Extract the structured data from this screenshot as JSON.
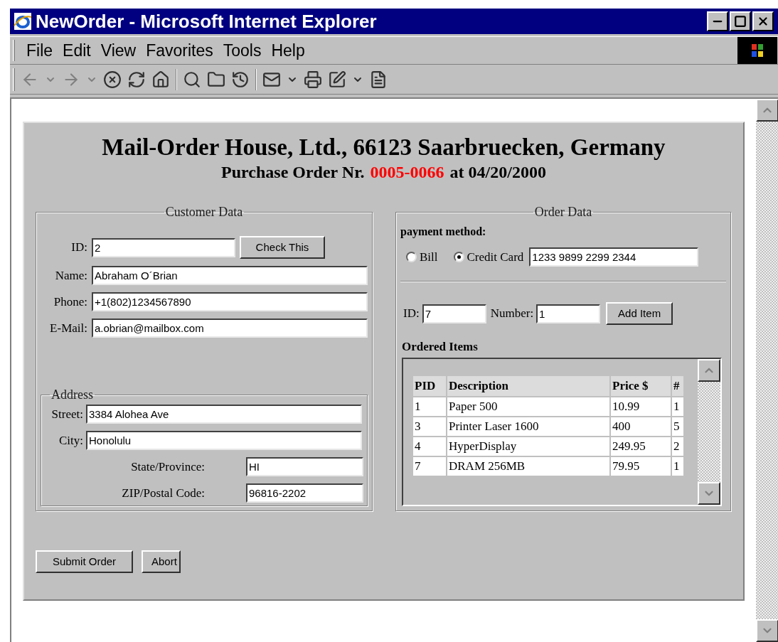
{
  "window": {
    "title": "NewOrder - Microsoft Internet Explorer"
  },
  "menu": [
    "File",
    "Edit",
    "View",
    "Favorites",
    "Tools",
    "Help"
  ],
  "page": {
    "heading": "Mail-Order House, Ltd., 66123 Saarbruecken, Germany",
    "subtitle": {
      "prefix": "Purchase Order Nr.",
      "order_number": "0005-0066",
      "suffix": "at 04/20/2000"
    },
    "customer": {
      "legend": "Customer Data",
      "id": {
        "label": "ID:",
        "value": "2"
      },
      "check_button": "Check This",
      "fields": [
        {
          "label": "Name:",
          "value": "Abraham O´Brian"
        },
        {
          "label": "Phone:",
          "value": "+1(802)1234567890"
        },
        {
          "label": "E-Mail:",
          "value": "a.obrian@mailbox.com"
        }
      ],
      "address": {
        "legend": "Address",
        "fields": [
          {
            "label": "Street:",
            "value": "3384 Alohea Ave"
          },
          {
            "label": "City:",
            "value": "Honolulu"
          }
        ],
        "fields_right": [
          {
            "label": "State/Province:",
            "value": "HI"
          },
          {
            "label": "ZIP/Postal Code:",
            "value": "96816-2202"
          }
        ]
      }
    },
    "order": {
      "legend": "Order Data",
      "payment_label": "payment method:",
      "payment_options": [
        {
          "label": "Bill",
          "selected": false
        },
        {
          "label": "Credit Card",
          "selected": true
        }
      ],
      "card_number": "1233 9899 2299 2344",
      "item_id": {
        "label": "ID:",
        "value": "7"
      },
      "number": {
        "label": "Number:",
        "value": "1"
      },
      "add_button": "Add Item",
      "items_title": "Ordered Items",
      "table": {
        "columns": [
          "PID",
          "Description",
          "Price $",
          "#"
        ],
        "rows": [
          [
            "1",
            "Paper 500",
            "10.99",
            "1"
          ],
          [
            "3",
            "Printer Laser 1600",
            "400",
            "5"
          ],
          [
            "4",
            "HyperDisplay",
            "249.95",
            "2"
          ],
          [
            "7",
            "DRAM 256MB",
            "79.95",
            "1"
          ]
        ]
      }
    },
    "buttons": [
      "Submit Order",
      "Abort"
    ]
  }
}
